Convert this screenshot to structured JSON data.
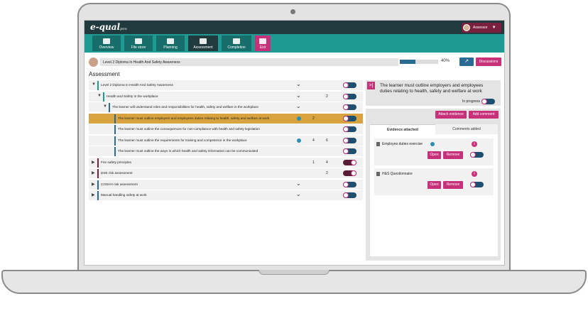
{
  "app": {
    "logo": "e-qual",
    "logo_sup": "pro"
  },
  "user": {
    "name": "Assessor",
    "caret": "▼"
  },
  "nav": {
    "tabs": [
      {
        "label": "Overview",
        "icon": "grid-icon"
      },
      {
        "label": "File store",
        "icon": "upload-icon"
      },
      {
        "label": "Planning",
        "icon": "calendar-icon"
      },
      {
        "label": "Assessment",
        "icon": "assessment-icon"
      },
      {
        "label": "Completion",
        "icon": "grid-icon"
      },
      {
        "label": "Exit",
        "icon": "exit-icon"
      }
    ],
    "active": "Assessment"
  },
  "course": {
    "title": "Level 2 Diploma In Health And Safety Awareness",
    "progress_percent": 40,
    "progress_text": "40%",
    "trend_icon": "↗",
    "discussions_label": "Discussions"
  },
  "assessment": {
    "title": "Assessment",
    "rows": [
      {
        "text": "Level 2 Diploma In Health And Safety Awareness",
        "caret": "▼",
        "col2": "",
        "col3": "",
        "chev": "⌄"
      },
      {
        "text": "Health and Safety in the workplace",
        "caret": "▼",
        "col2": "",
        "col3": "2",
        "chev": "⌄"
      },
      {
        "text": "The learner will understand roles and responsibilities for health, safety and welfare in the workplace",
        "caret": "▼",
        "col2": "",
        "col3": "",
        "chev": "⌄"
      },
      {
        "text": "The learner must outline employers and employees duties relating to health, safety and welfare at work",
        "caret": "",
        "col2": "2",
        "col3": "",
        "chev": ""
      },
      {
        "text": "The learner must outline the consequences for non-compliance with health and safety legislation",
        "caret": "",
        "col2": "",
        "col3": "",
        "chev": ""
      },
      {
        "text": "The learner must outline the requirements for training and competence in the workplace",
        "caret": "",
        "col2": "4",
        "col3": "6",
        "chev": ""
      },
      {
        "text": "The learner must outline the ways in which health and safety information can be communicated",
        "caret": "",
        "col2": "",
        "col3": "",
        "chev": ""
      },
      {
        "text": "Fire safety principles",
        "caret": "▶",
        "col2": "1",
        "col3": "4",
        "chev": ""
      },
      {
        "text": "DSE risk assessment",
        "caret": "▶",
        "col2": "",
        "col3": "2",
        "chev": ""
      },
      {
        "text": "COSHH risk assessment",
        "caret": "▶",
        "col2": "",
        "col3": "",
        "chev": "⌄"
      },
      {
        "text": "Manual handling safety at work",
        "caret": "▶",
        "col2": "",
        "col3": "",
        "chev": "⌄"
      }
    ]
  },
  "sidepanel": {
    "collapse_icon": ">|",
    "title": "The learner must outline employers and employees duties relating to health, safety and welfare at work",
    "status": "In progress",
    "attach_label": "Attach evidence",
    "comment_label": "Add comment",
    "tabs": [
      "Evidence attached",
      "Comments added"
    ],
    "evidence": [
      {
        "name": "Employee duties exercise",
        "open": "Open",
        "remove": "Remove",
        "info": "i"
      },
      {
        "name": "H&S Questionnaire",
        "open": "Open",
        "remove": "Remove",
        "info": "i"
      }
    ]
  },
  "colors": {
    "header": "#203a3d",
    "nav": "#1f9a93",
    "accent": "#c7317a",
    "highlight": "#d9a43f",
    "blue": "#2a6b95"
  }
}
